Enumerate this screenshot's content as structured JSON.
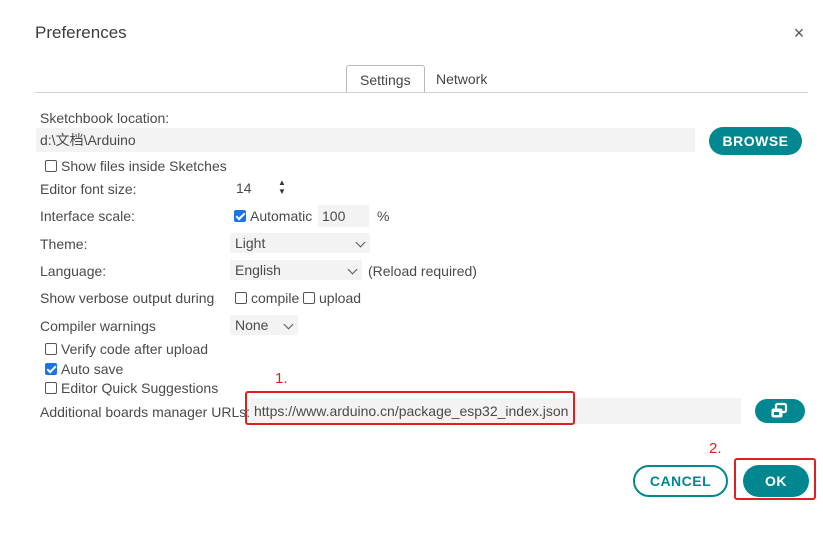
{
  "dialog": {
    "title": "Preferences",
    "close_glyph": "×"
  },
  "tabs": [
    {
      "label": "Settings",
      "active": true
    },
    {
      "label": "Network",
      "active": false
    }
  ],
  "sketchbook": {
    "label": "Sketchbook location:",
    "value": "d:\\文档\\Arduino",
    "browse_label": "BROWSE"
  },
  "show_files": {
    "label": "Show files inside Sketches",
    "checked": false
  },
  "editor_font_size": {
    "label": "Editor font size:",
    "value": "14"
  },
  "interface_scale": {
    "label": "Interface scale:",
    "automatic_label": "Automatic",
    "automatic_checked": true,
    "value": "100",
    "unit": "%"
  },
  "theme": {
    "label": "Theme:",
    "value": "Light"
  },
  "language": {
    "label": "Language:",
    "value": "English",
    "note": "(Reload required)"
  },
  "verbose": {
    "label": "Show verbose output during",
    "compile_label": "compile",
    "compile_checked": false,
    "upload_label": "upload",
    "upload_checked": false
  },
  "compiler_warnings": {
    "label": "Compiler warnings",
    "value": "None"
  },
  "verify_code": {
    "label": "Verify code after upload",
    "checked": false
  },
  "auto_save": {
    "label": "Auto save",
    "checked": true
  },
  "quick_suggestions": {
    "label": "Editor Quick Suggestions",
    "checked": false
  },
  "boards_urls": {
    "label": "Additional boards manager URLs:",
    "value": "https://www.arduino.cn/package_esp32_index.json"
  },
  "annotations": {
    "step1": "1.",
    "step2": "2."
  },
  "footer": {
    "cancel_label": "CANCEL",
    "ok_label": "OK"
  },
  "colors": {
    "accent": "#00878f",
    "annotation": "#e02020",
    "checkbox_checked": "#1a73e8"
  }
}
